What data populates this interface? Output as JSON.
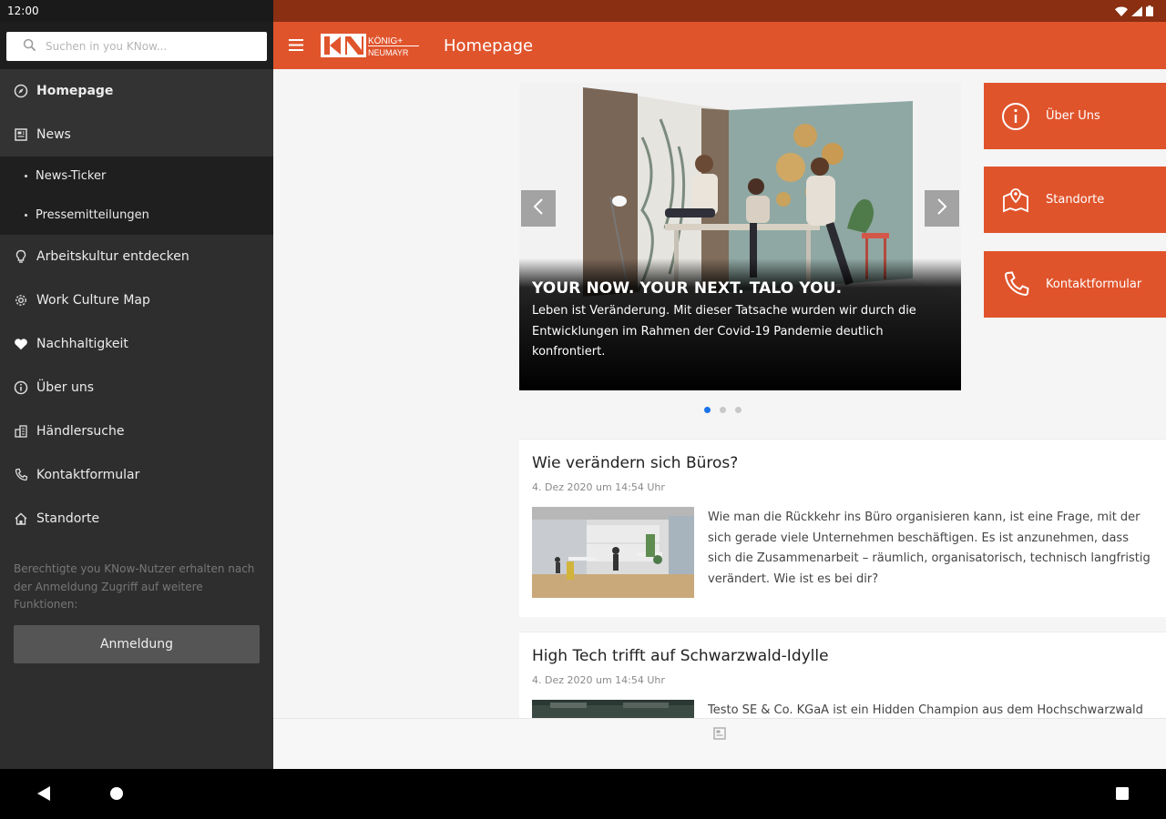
{
  "status": {
    "time": "12:00"
  },
  "search": {
    "placeholder": "Suchen in you KNow..."
  },
  "sidebar": {
    "items": [
      {
        "label": "Homepage",
        "icon": "compass-icon"
      },
      {
        "label": "News",
        "icon": "newspaper-icon"
      },
      {
        "label": "News-Ticker"
      },
      {
        "label": "Pressemitteilungen"
      },
      {
        "label": "Arbeitskultur entdecken",
        "icon": "lightbulb-icon"
      },
      {
        "label": "Work Culture Map",
        "icon": "gear-icon"
      },
      {
        "label": "Nachhaltigkeit",
        "icon": "heart-icon"
      },
      {
        "label": "Über uns",
        "icon": "info-icon"
      },
      {
        "label": "Händlersuche",
        "icon": "buildings-icon"
      },
      {
        "label": "Kontaktformular",
        "icon": "phone-icon"
      },
      {
        "label": "Standorte",
        "icon": "home-icon"
      }
    ],
    "note": "Berechtigte you KNow-Nutzer erhalten nach der Anmeldung Zugriff auf weitere Funktionen:",
    "login_label": "Anmeldung"
  },
  "toolbar": {
    "logo_text_top": "KÖNIG+",
    "logo_text_bottom": "NEUMAYR",
    "title": "Homepage"
  },
  "carousel": {
    "title": "YOUR NOW. YOUR NEXT. TALO YOU.",
    "text": "Leben ist Veränderung. Mit dieser Tatsache wurden wir durch die Entwicklungen im Rahmen der Covid-19 Pandemie deutlich konfrontiert.",
    "current_slide": 1,
    "total_slides": 3
  },
  "quick_buttons": [
    {
      "label": "Über Uns",
      "icon": "info-circle-icon"
    },
    {
      "label": "Standorte",
      "icon": "map-pin-icon"
    },
    {
      "label": "Kontaktformular",
      "icon": "phone-icon"
    }
  ],
  "articles": [
    {
      "title": "Wie verändern sich Büros?",
      "date": "4. Dez 2020 um 14:54 Uhr",
      "lines": [
        "Wie man die Rückkehr ins Büro organisieren kann, ist eine Frage, mit der",
        "sich gerade viele Unternehmen beschäftigen. Es ist anzunehmen, dass",
        "sich die Zusammenarbeit – räumlich, organisatorisch, technisch langfristig",
        "verändert. Wie ist es bei dir?"
      ]
    },
    {
      "title": "High Tech trifft auf Schwarzwald-Idylle",
      "date": "4. Dez 2020 um 14:54 Uhr",
      "lines": [
        "Testo SE & Co. KGaA ist ein Hidden Champion aus dem Hochschwarzwald"
      ]
    }
  ],
  "colors": {
    "accent": "#e0542c",
    "status_bar": "#8a2f12",
    "sidebar": "#2e2e2e",
    "dot_active": "#1a73e8"
  }
}
